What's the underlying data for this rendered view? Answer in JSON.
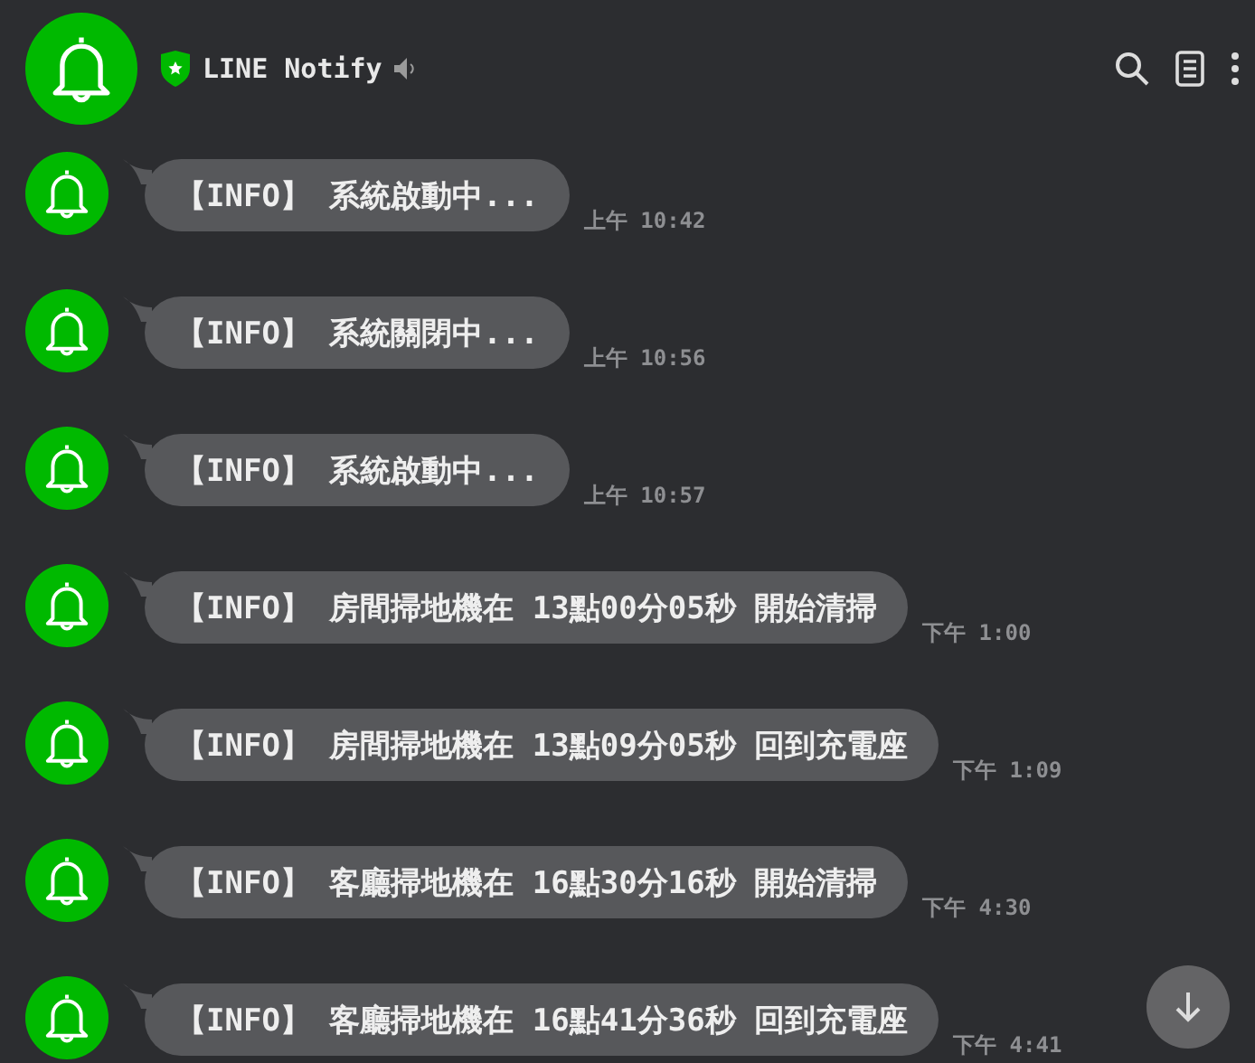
{
  "header": {
    "title": "LINE Notify"
  },
  "messages": [
    {
      "text": "【INFO】 系統啟動中...",
      "time": "上午 10:42"
    },
    {
      "text": "【INFO】 系統關閉中...",
      "time": "上午 10:56"
    },
    {
      "text": "【INFO】 系統啟動中...",
      "time": "上午 10:57"
    },
    {
      "text": "【INFO】 房間掃地機在 13點00分05秒 開始清掃",
      "time": "下午 1:00"
    },
    {
      "text": "【INFO】 房間掃地機在 13點09分05秒 回到充電座",
      "time": "下午 1:09"
    },
    {
      "text": "【INFO】 客廳掃地機在 16點30分16秒 開始清掃",
      "time": "下午 4:30"
    },
    {
      "text": "【INFO】 客廳掃地機在 16點41分36秒 回到充電座",
      "time": "下午 4:41"
    }
  ]
}
